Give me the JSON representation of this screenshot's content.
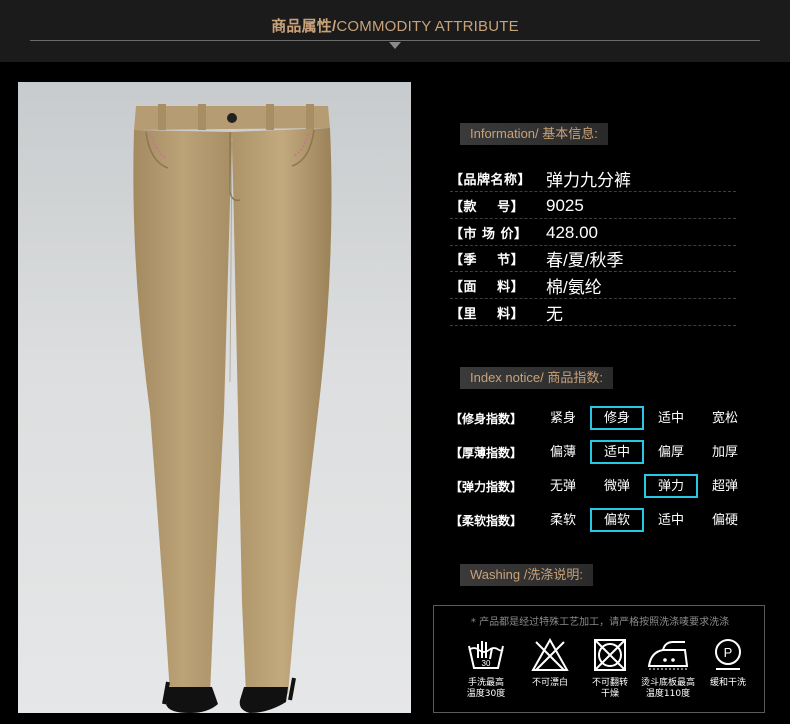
{
  "header": {
    "title_cn": "商品属性/",
    "title_en": "COMMODITY ATTRIBUTE"
  },
  "photo": {
    "subject": "khaki-cropped-pants",
    "colors": {
      "pants": "#b49a70",
      "background": "#d8dadb",
      "shoes": "#111111"
    }
  },
  "info_section": {
    "tag": "Information/ 基本信息:",
    "rows": [
      {
        "label": "【品牌名称】",
        "value": "弹力九分裤"
      },
      {
        "label": "【款    号】",
        "value": "9025"
      },
      {
        "label": "【市 场 价】",
        "value": "428.00"
      },
      {
        "label": "【季    节】",
        "value": "春/夏/秋季"
      },
      {
        "label": "【面    料】",
        "value": "棉/氨纶"
      },
      {
        "label": "【里    料】",
        "value": "无"
      }
    ]
  },
  "index_section": {
    "tag": "Index notice/ 商品指数:",
    "rows": [
      {
        "label": "【修身指数】",
        "options": [
          "紧身",
          "修身",
          "适中",
          "宽松"
        ],
        "selected": 1
      },
      {
        "label": "【厚薄指数】",
        "options": [
          "偏薄",
          "适中",
          "偏厚",
          "加厚"
        ],
        "selected": 1
      },
      {
        "label": "【弹力指数】",
        "options": [
          "无弹",
          "微弹",
          "弹力",
          "超弹"
        ],
        "selected": 2
      },
      {
        "label": "【柔软指数】",
        "options": [
          "柔软",
          "偏软",
          "适中",
          "偏硬"
        ],
        "selected": 1
      }
    ],
    "highlight_color": "#29c6e6"
  },
  "washing_section": {
    "tag": "Washing /洗涤说明:",
    "note": "* 产品都是经过特殊工艺加工，请严格按照洗涤唛要求洗涤",
    "icons": [
      {
        "icon": "hand-wash-30-icon",
        "label_line1": "手洗最高",
        "label_line2": "温度30度"
      },
      {
        "icon": "no-bleach-icon",
        "label_line1": "不可漂白",
        "label_line2": ""
      },
      {
        "icon": "no-tumble-dry-icon",
        "label_line1": "不可翻转",
        "label_line2": "干燥"
      },
      {
        "icon": "iron-110-icon",
        "label_line1": "烫斗底板最高",
        "label_line2": "温度110度"
      },
      {
        "icon": "dry-clean-p-icon",
        "label_line1": "缓和干洗",
        "label_line2": ""
      }
    ]
  },
  "colors": {
    "accent": "#c8a27a",
    "background": "#000000",
    "header_bg": "#1b1b1b"
  }
}
